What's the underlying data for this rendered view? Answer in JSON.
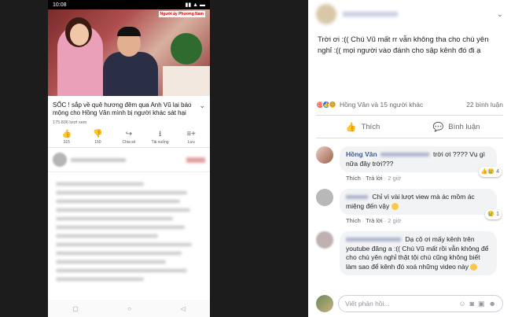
{
  "phone": {
    "status_time": "10:08",
    "status_right": "▮▮ ▲ ▬",
    "thumb_sign": "Người ấy Phương Nam",
    "video_title": "SỐC ! sắp về quê hương đêm qua Anh Vũ lại báo mộng cho Hồng Vân mình bị người khác sát hại",
    "views": "175.836 lượt xem",
    "actions": [
      {
        "icon": "👍",
        "label": "315"
      },
      {
        "icon": "👎",
        "label": "150"
      },
      {
        "icon": "↪",
        "label": "Chia sẻ"
      },
      {
        "icon": "⭳",
        "label": "Tải xuống"
      },
      {
        "icon": "≡+",
        "label": "Lưu"
      }
    ],
    "nav": [
      "▢",
      "○",
      "◁"
    ]
  },
  "fb": {
    "post_text": "Trời ơi :(( Chú Vũ mất rr vẫn không tha cho chú yên nghỉ :(( mọi người vào đánh cho sập kênh đó đi ạ",
    "reactions_text": "Hồng Vân và 15 người khác",
    "comment_count": "22 bình luận",
    "like_label": "Thích",
    "comment_label": "Bình luận",
    "comments": [
      {
        "author": "Hồng Vân",
        "text": "trời ơi ???? Vụ gì nữa đây trời???",
        "time": "2 giờ",
        "badge": "4"
      },
      {
        "author": "",
        "text": "Chỉ vì vài lượt view mà ác mồm ác miệng đến vậy",
        "time": "2 giờ",
        "badge": "1"
      },
      {
        "author": "",
        "text": "Dạ cô ơi mấy kênh trên youtube đăng a :(( Chú Vũ mất rồi vẫn không để cho chú yên nghỉ thật tội chú cũng không biết làm sao để kênh đó xoá những video này",
        "time": "",
        "badge": ""
      }
    ],
    "meta_like": "Thích",
    "meta_reply": "Trả lời",
    "write_placeholder": "Viết phản hồi..."
  }
}
